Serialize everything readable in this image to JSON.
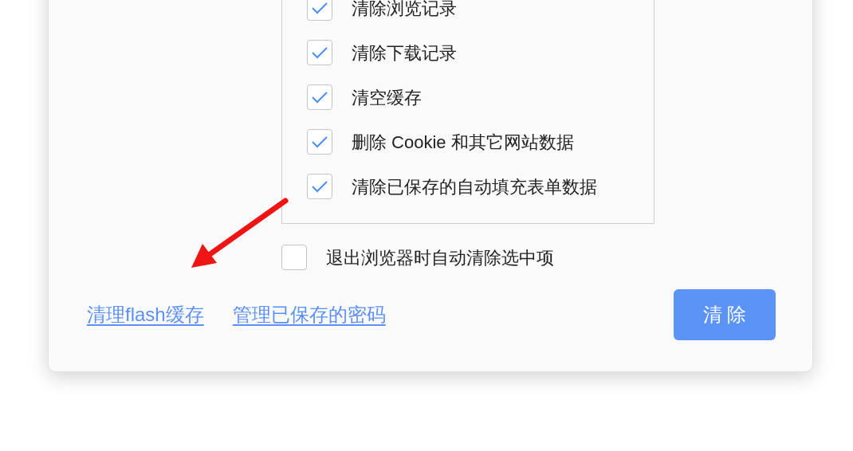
{
  "options": [
    {
      "label": "清除浏览记录",
      "checked": true
    },
    {
      "label": "清除下载记录",
      "checked": true
    },
    {
      "label": "清空缓存",
      "checked": true
    },
    {
      "label": "删除 Cookie 和其它网站数据",
      "checked": true
    },
    {
      "label": "清除已保存的自动填充表单数据",
      "checked": true
    }
  ],
  "auto_clear": {
    "label": "退出浏览器时自动清除选中项",
    "checked": false
  },
  "links": [
    "清理flash缓存",
    "管理已保存的密码"
  ],
  "clear_button": "清 除"
}
